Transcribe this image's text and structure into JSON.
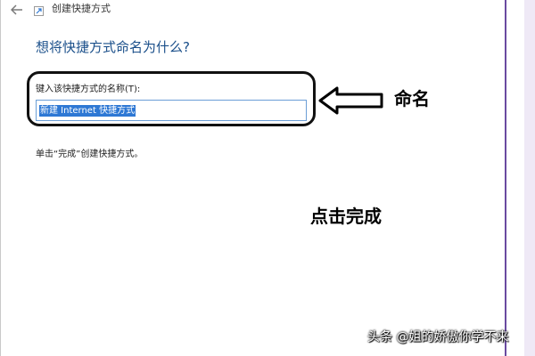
{
  "window": {
    "title": "创建快捷方式",
    "back_icon": "back-arrow-icon",
    "app_icon": "shortcut-icon"
  },
  "main": {
    "heading": "想将快捷方式命名为什么?",
    "field_label": "键入该快捷方式的名称(T):",
    "field_value": "新建 Internet 快捷方式",
    "instruction": "单击“完成”创建快捷方式。"
  },
  "annotations": {
    "name_label": "命名",
    "finish_label": "点击完成",
    "arrow_icon": "left-arrow-icon"
  },
  "watermark": {
    "text": "头条 @姐的娇傲你学不来"
  },
  "colors": {
    "heading": "#1a4f8a",
    "selection": "#2e78d4",
    "input_border": "#6b9ed6",
    "window_edge": "#6a4aa0"
  }
}
